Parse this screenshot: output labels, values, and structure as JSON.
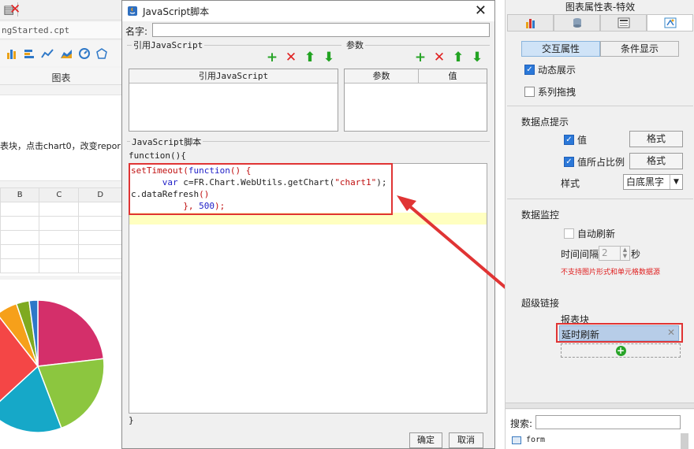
{
  "left": {
    "file_name": "ngStarted.cpt",
    "chart_label": "图表",
    "description": "表块，点击chart0，改变repor",
    "grid_cols": [
      "B",
      "C",
      "D"
    ]
  },
  "dialog": {
    "title": "JavaScript脚本",
    "close": "✕",
    "name_label": "名字:",
    "name_value": "",
    "ref_section": "引用JavaScript",
    "params_section": "参数",
    "ref_table_header": "引用JavaScript",
    "params_headers": [
      "参数",
      "值"
    ],
    "script_section": "JavaScript脚本",
    "func_open": "function(){",
    "func_close": "}",
    "code": {
      "l1_a": "setTimeout(",
      "l1_kw": "function",
      "l1_b": "() {",
      "l2_a": "      ",
      "l2_kw": "var",
      "l2_b": " c=FR.Chart.WebUtils.getChart(",
      "l2_str": "\"chart1\"",
      "l2_c": ");",
      "l3_a": "c.dataRefresh",
      "l3_b": "()",
      "l4_a": "          }, ",
      "l4_num": "500",
      "l4_b": ");"
    },
    "ok": "确定",
    "cancel": "取消"
  },
  "right": {
    "title": "图表属性表-特效",
    "seg_tabs": [
      "交互属性",
      "条件显示"
    ],
    "dynamic_show": "动态展示",
    "series_drag": "系列拖拽",
    "tooltip_section": "数据点提示",
    "value_label": "值",
    "percent_label": "值所占比例",
    "format_label": "格式",
    "style_label": "样式",
    "style_value": "白底黑字",
    "monitor_section": "数据监控",
    "auto_refresh": "自动刷新",
    "interval_label": "时间间隔",
    "interval_value": "2",
    "seconds": "秒",
    "warning": "不支持图片形式和单元格数据源",
    "hyperlink_section": "超级链接",
    "link_items": [
      "报表块",
      "延时刷新"
    ],
    "search_label": "搜索:",
    "tree_item": "form"
  },
  "colors": {
    "highlight_box": "#e03434",
    "selected_item": "#b7cde8",
    "warning": "#e02020"
  },
  "chart_data": {
    "type": "pie",
    "values": [
      22,
      20,
      18,
      25,
      5,
      3,
      2
    ],
    "colors": [
      "#d42f6a",
      "#8cc63f",
      "#16a8c8",
      "#f44646",
      "#f6a01a",
      "#7faa20",
      "#2e78c8"
    ]
  }
}
